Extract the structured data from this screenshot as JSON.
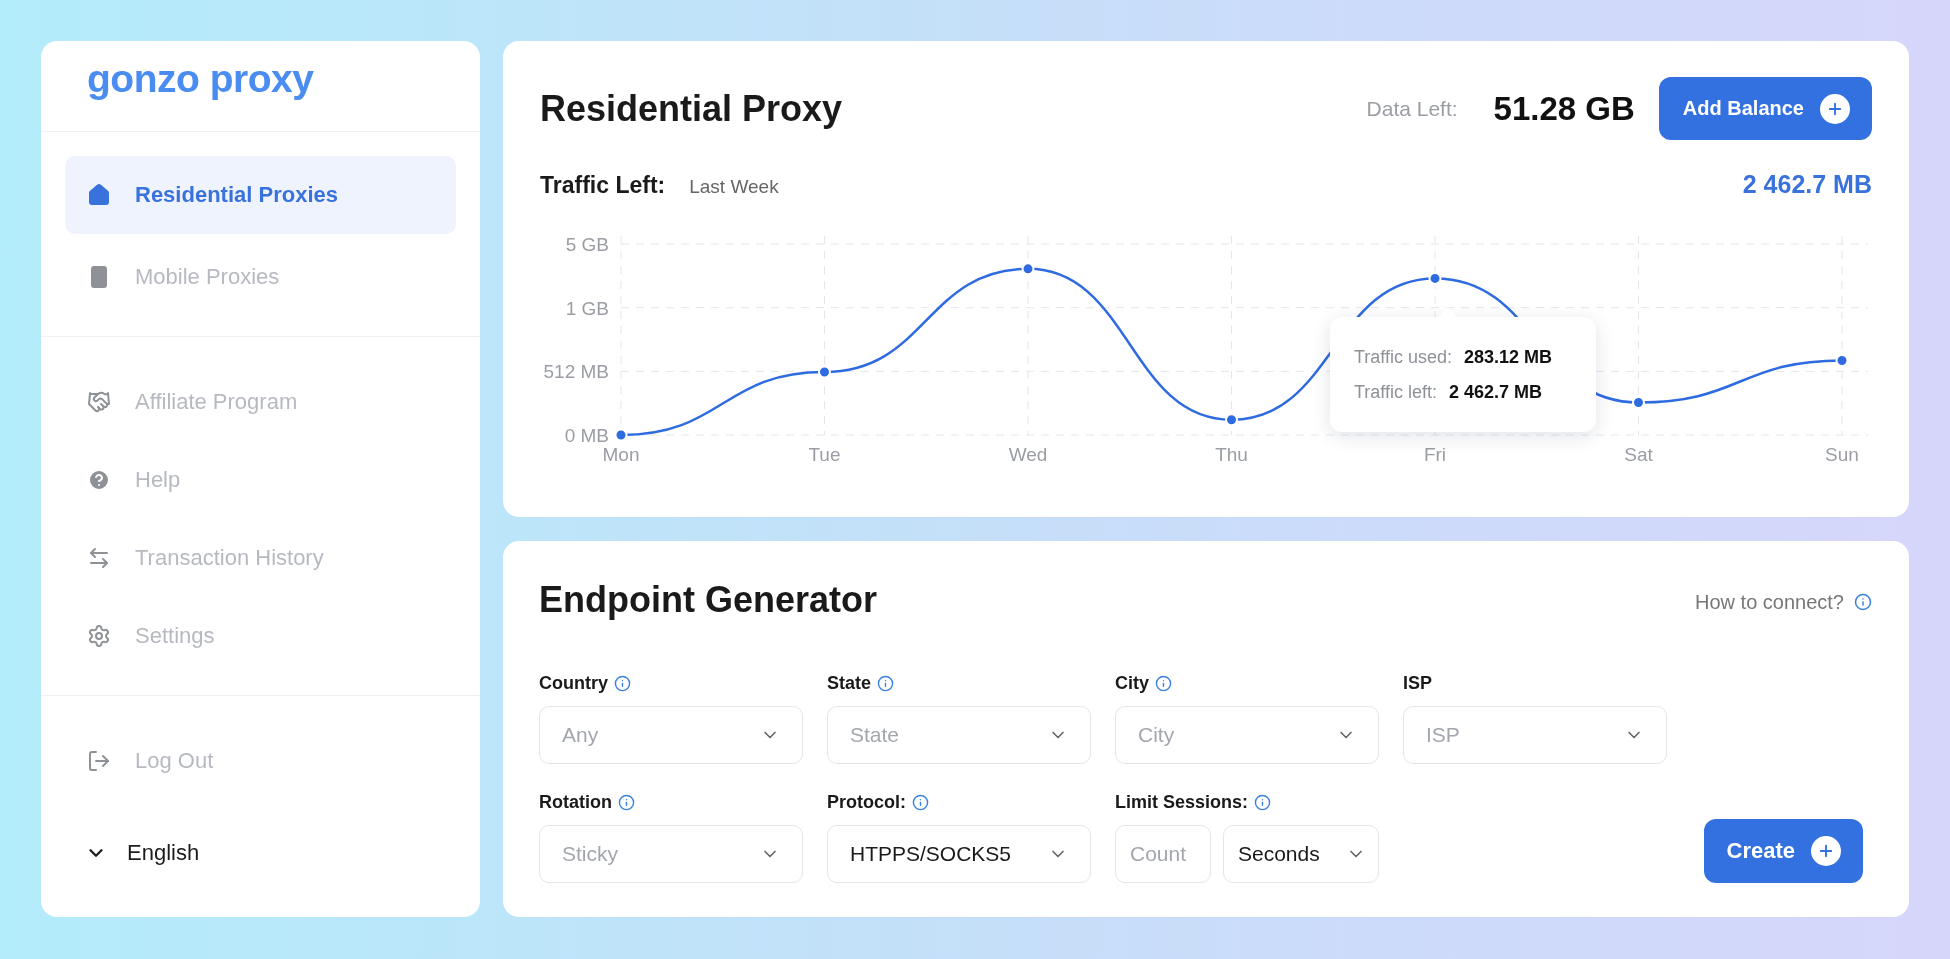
{
  "sidebar": {
    "logo": "gonzo proxy",
    "sections": [
      {
        "items": [
          {
            "label": "Residential Proxies",
            "kind": "house",
            "selected": true
          },
          {
            "label": "Mobile Proxies",
            "kind": "phone",
            "selected": false
          }
        ]
      },
      {
        "items": [
          {
            "label": "Affiliate Program",
            "kind": "handshake",
            "selected": false
          },
          {
            "label": "Help",
            "kind": "help",
            "selected": false
          },
          {
            "label": "Transaction History",
            "kind": "transfer",
            "selected": false
          },
          {
            "label": "Settings",
            "kind": "gear",
            "selected": false
          }
        ]
      },
      {
        "items": [
          {
            "label": "Log Out",
            "kind": "logout",
            "selected": false
          }
        ]
      }
    ],
    "language": "English"
  },
  "residential": {
    "title": "Residential Proxy",
    "data_left_label": "Data Left:",
    "data_left_value": "51.28 GB",
    "add_button": "Add Balance",
    "traffic_label": "Traffic Left:",
    "period": "Last Week",
    "traffic_total": "2 462.7 MB",
    "chart": {
      "x_labels": [
        "Mon",
        "Tue",
        "Wed",
        "Thu",
        "Fri",
        "Sat",
        "Sun"
      ],
      "y_labels": [
        "5 GB",
        "1 GB",
        "512 MB",
        "0 MB"
      ]
    },
    "tooltip": {
      "rows": [
        {
          "label": "Traffic used:",
          "value": "283.12 MB"
        },
        {
          "label": "Traffic left:",
          "value": "2 462.7 MB"
        }
      ]
    }
  },
  "endpoint": {
    "title": "Endpoint Generator",
    "help_link": "How to connect?",
    "rows": [
      {
        "fields": [
          {
            "label": "Country",
            "info": true,
            "controls": [
              {
                "kind": "select",
                "placeholder": "Any"
              }
            ]
          },
          {
            "label": "State",
            "info": true,
            "controls": [
              {
                "kind": "select",
                "placeholder": "State"
              }
            ]
          },
          {
            "label": "City",
            "info": true,
            "controls": [
              {
                "kind": "select",
                "placeholder": "City"
              }
            ]
          },
          {
            "label": "ISP",
            "info": false,
            "controls": [
              {
                "kind": "select",
                "placeholder": "ISP"
              }
            ]
          }
        ]
      },
      {
        "fields": [
          {
            "label": "Rotation",
            "info": true,
            "controls": [
              {
                "kind": "select",
                "placeholder": "Sticky"
              }
            ]
          },
          {
            "label": "Protocol:",
            "info": true,
            "controls": [
              {
                "kind": "select",
                "value": "HTPPS/SOCKS5"
              }
            ]
          },
          {
            "label": "Limit Sessions:",
            "info": true,
            "controls": [
              {
                "kind": "input",
                "placeholder": "Count"
              },
              {
                "kind": "select",
                "value": "Seconds"
              }
            ]
          }
        ]
      }
    ],
    "create_button": "Create"
  }
}
